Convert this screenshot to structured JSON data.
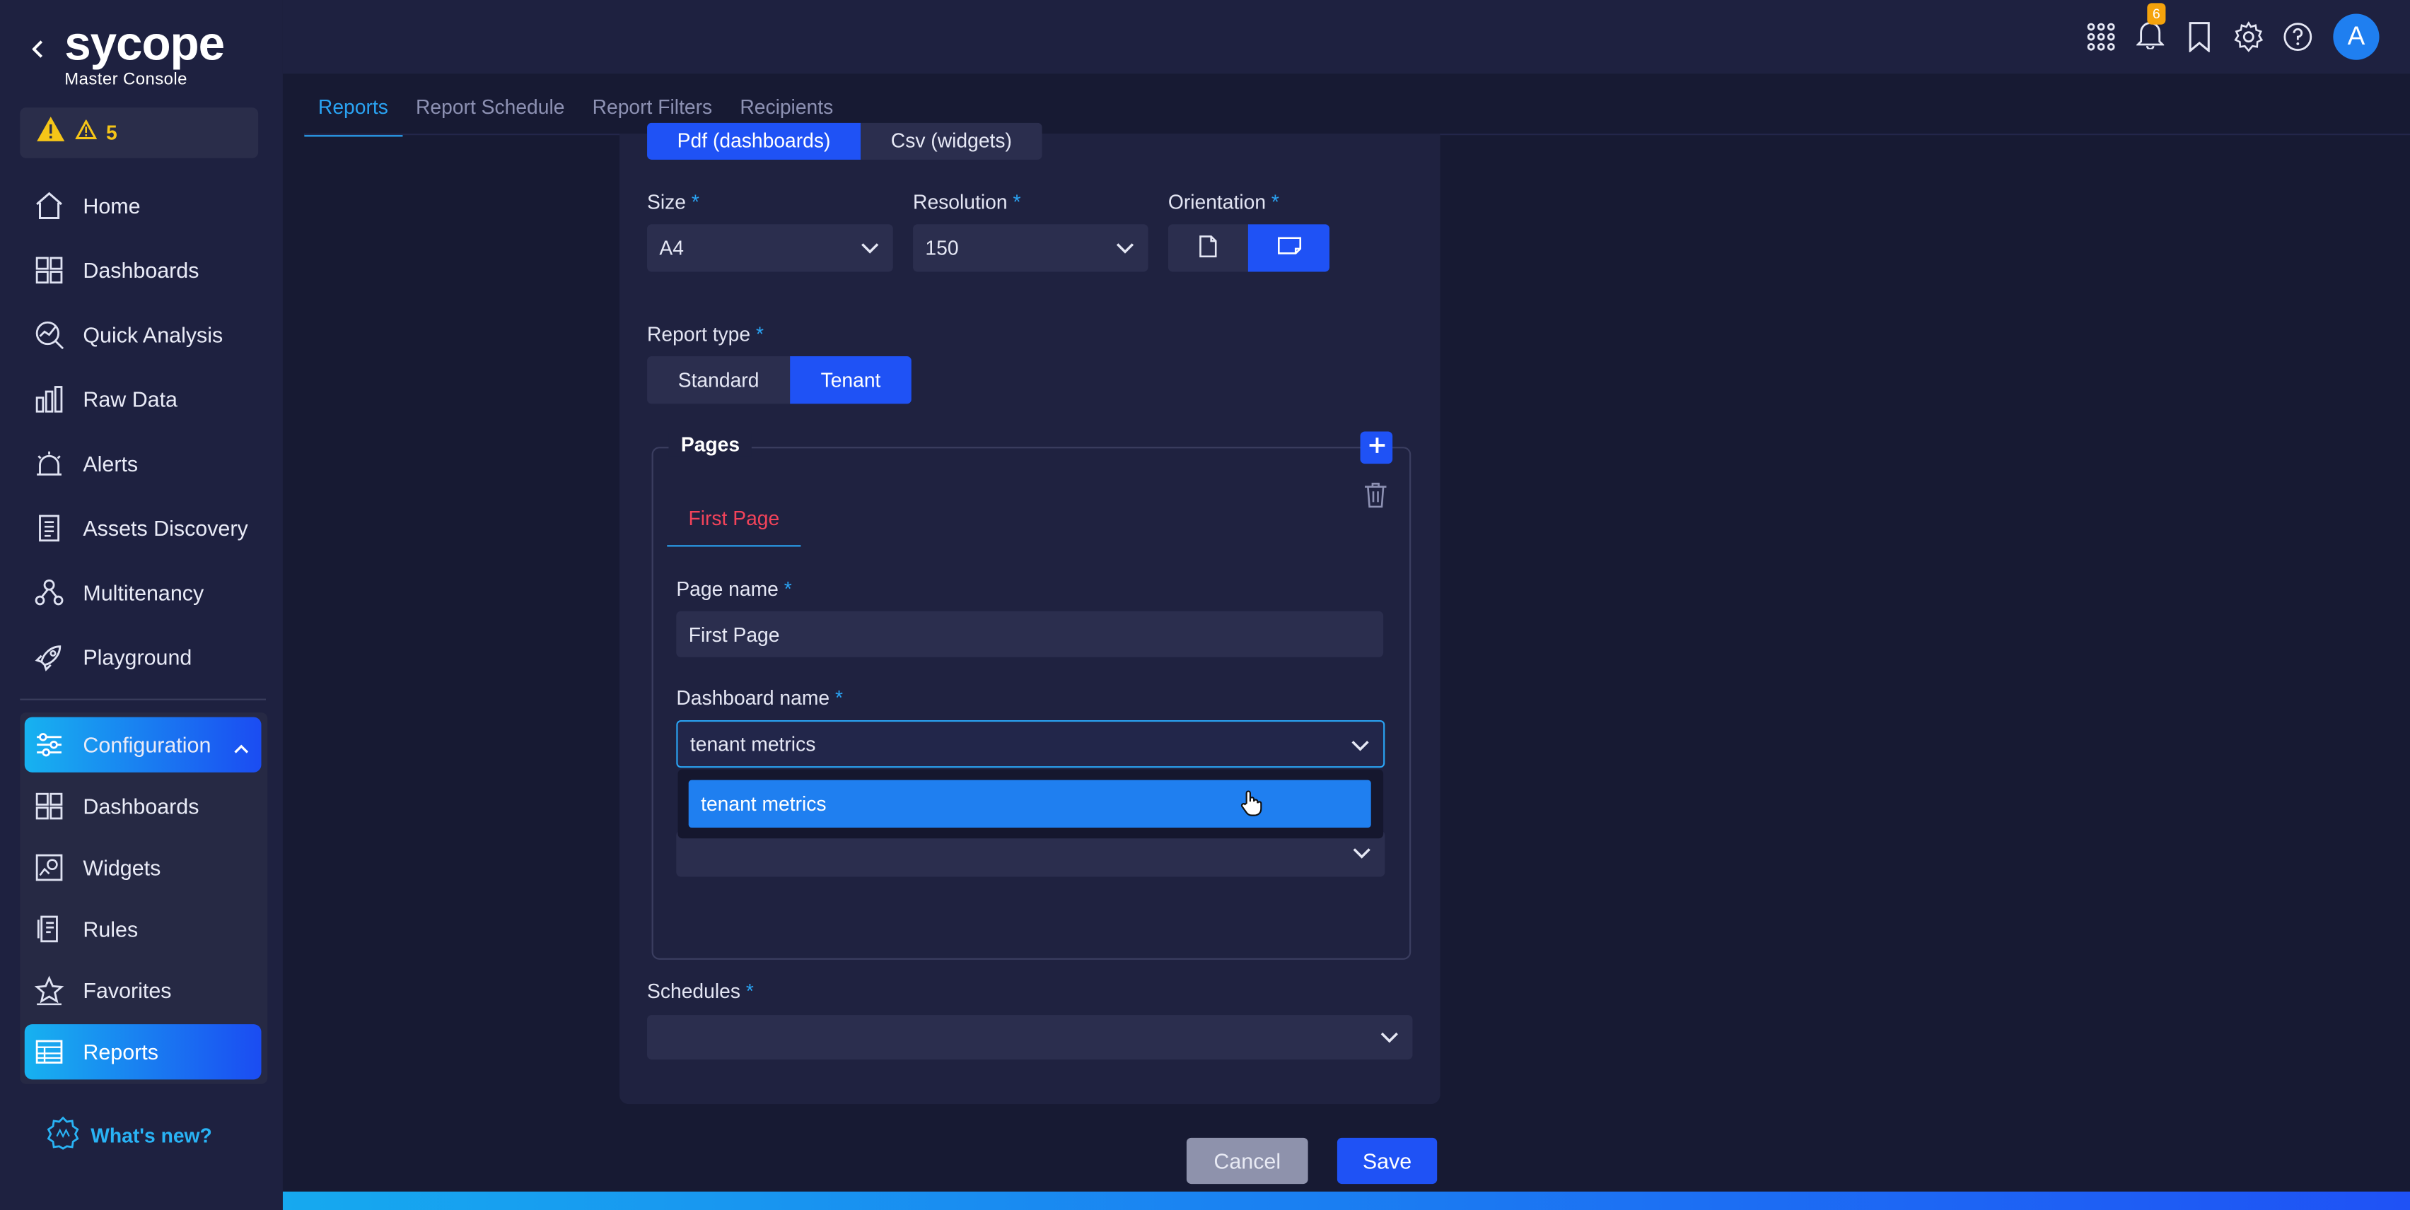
{
  "brand": {
    "name": "sycope",
    "subtitle": "Master Console"
  },
  "alerts": {
    "count": "5"
  },
  "sidebar": {
    "items": [
      {
        "label": "Home",
        "icon": "home-icon"
      },
      {
        "label": "Dashboards",
        "icon": "dashboards-icon"
      },
      {
        "label": "Quick Analysis",
        "icon": "quick-analysis-icon"
      },
      {
        "label": "Raw Data",
        "icon": "raw-data-icon"
      },
      {
        "label": "Alerts",
        "icon": "alarm-icon"
      },
      {
        "label": "Assets Discovery",
        "icon": "assets-icon"
      },
      {
        "label": "Multitenancy",
        "icon": "multitenancy-icon"
      },
      {
        "label": "Playground",
        "icon": "rocket-icon"
      }
    ],
    "configuration": {
      "label": "Configuration",
      "items": [
        {
          "label": "Dashboards"
        },
        {
          "label": "Widgets"
        },
        {
          "label": "Rules"
        },
        {
          "label": "Favorites"
        },
        {
          "label": "Reports"
        }
      ]
    },
    "whats_new": "What's new?"
  },
  "topbar": {
    "notifications_count": "6",
    "avatar_letter": "A"
  },
  "tabs": [
    "Reports",
    "Report Schedule",
    "Report Filters",
    "Recipients"
  ],
  "form": {
    "format": {
      "options": [
        "Pdf (dashboards)",
        "Csv (widgets)"
      ],
      "selected": "Pdf (dashboards)"
    },
    "size": {
      "label": "Size",
      "value": "A4"
    },
    "resolution": {
      "label": "Resolution",
      "value": "150"
    },
    "orientation": {
      "label": "Orientation",
      "selected": "landscape"
    },
    "report_type": {
      "label": "Report type",
      "options": [
        "Standard",
        "Tenant"
      ],
      "selected": "Tenant"
    },
    "pages": {
      "title": "Pages",
      "tab": "First Page",
      "page_name_label": "Page name",
      "page_name_value": "First Page",
      "dashboard_label": "Dashboard name",
      "dashboard_value": "tenant metrics",
      "dropdown_options": [
        "tenant metrics"
      ]
    },
    "schedules": {
      "label": "Schedules",
      "value": ""
    },
    "required_mark": "*"
  },
  "actions": {
    "cancel": "Cancel",
    "save": "Save"
  },
  "colors": {
    "accent": "#1f52f5",
    "highlight": "#2aa3f3",
    "page_tab": "#f2435a",
    "alert": "#f5c518"
  }
}
